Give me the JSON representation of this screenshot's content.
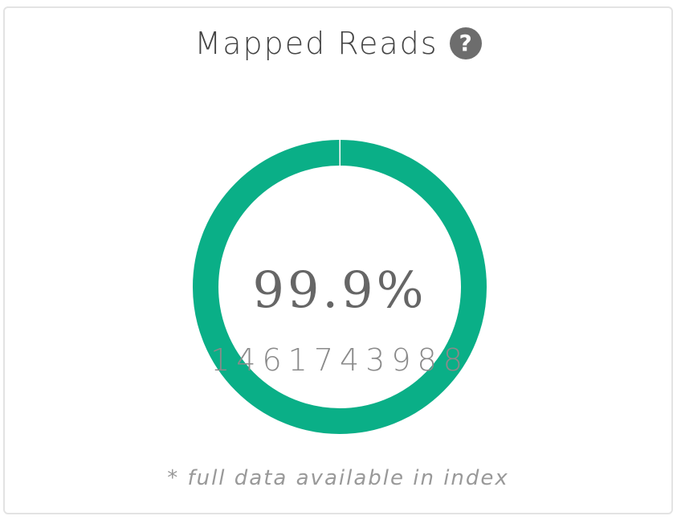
{
  "card": {
    "title": "Mapped Reads",
    "help_icon": "question-circle-icon",
    "footnote": "* full data available in index"
  },
  "chart_data": {
    "type": "pie",
    "variant": "donut",
    "categories": [
      "Mapped"
    ],
    "values": [
      99.9
    ],
    "center_value": "99.9%",
    "center_count": "1461743988",
    "colors": {
      "ring": "#0aaf87",
      "ring_remainder": "#e6e6e6",
      "gap": "#ffffff"
    }
  }
}
